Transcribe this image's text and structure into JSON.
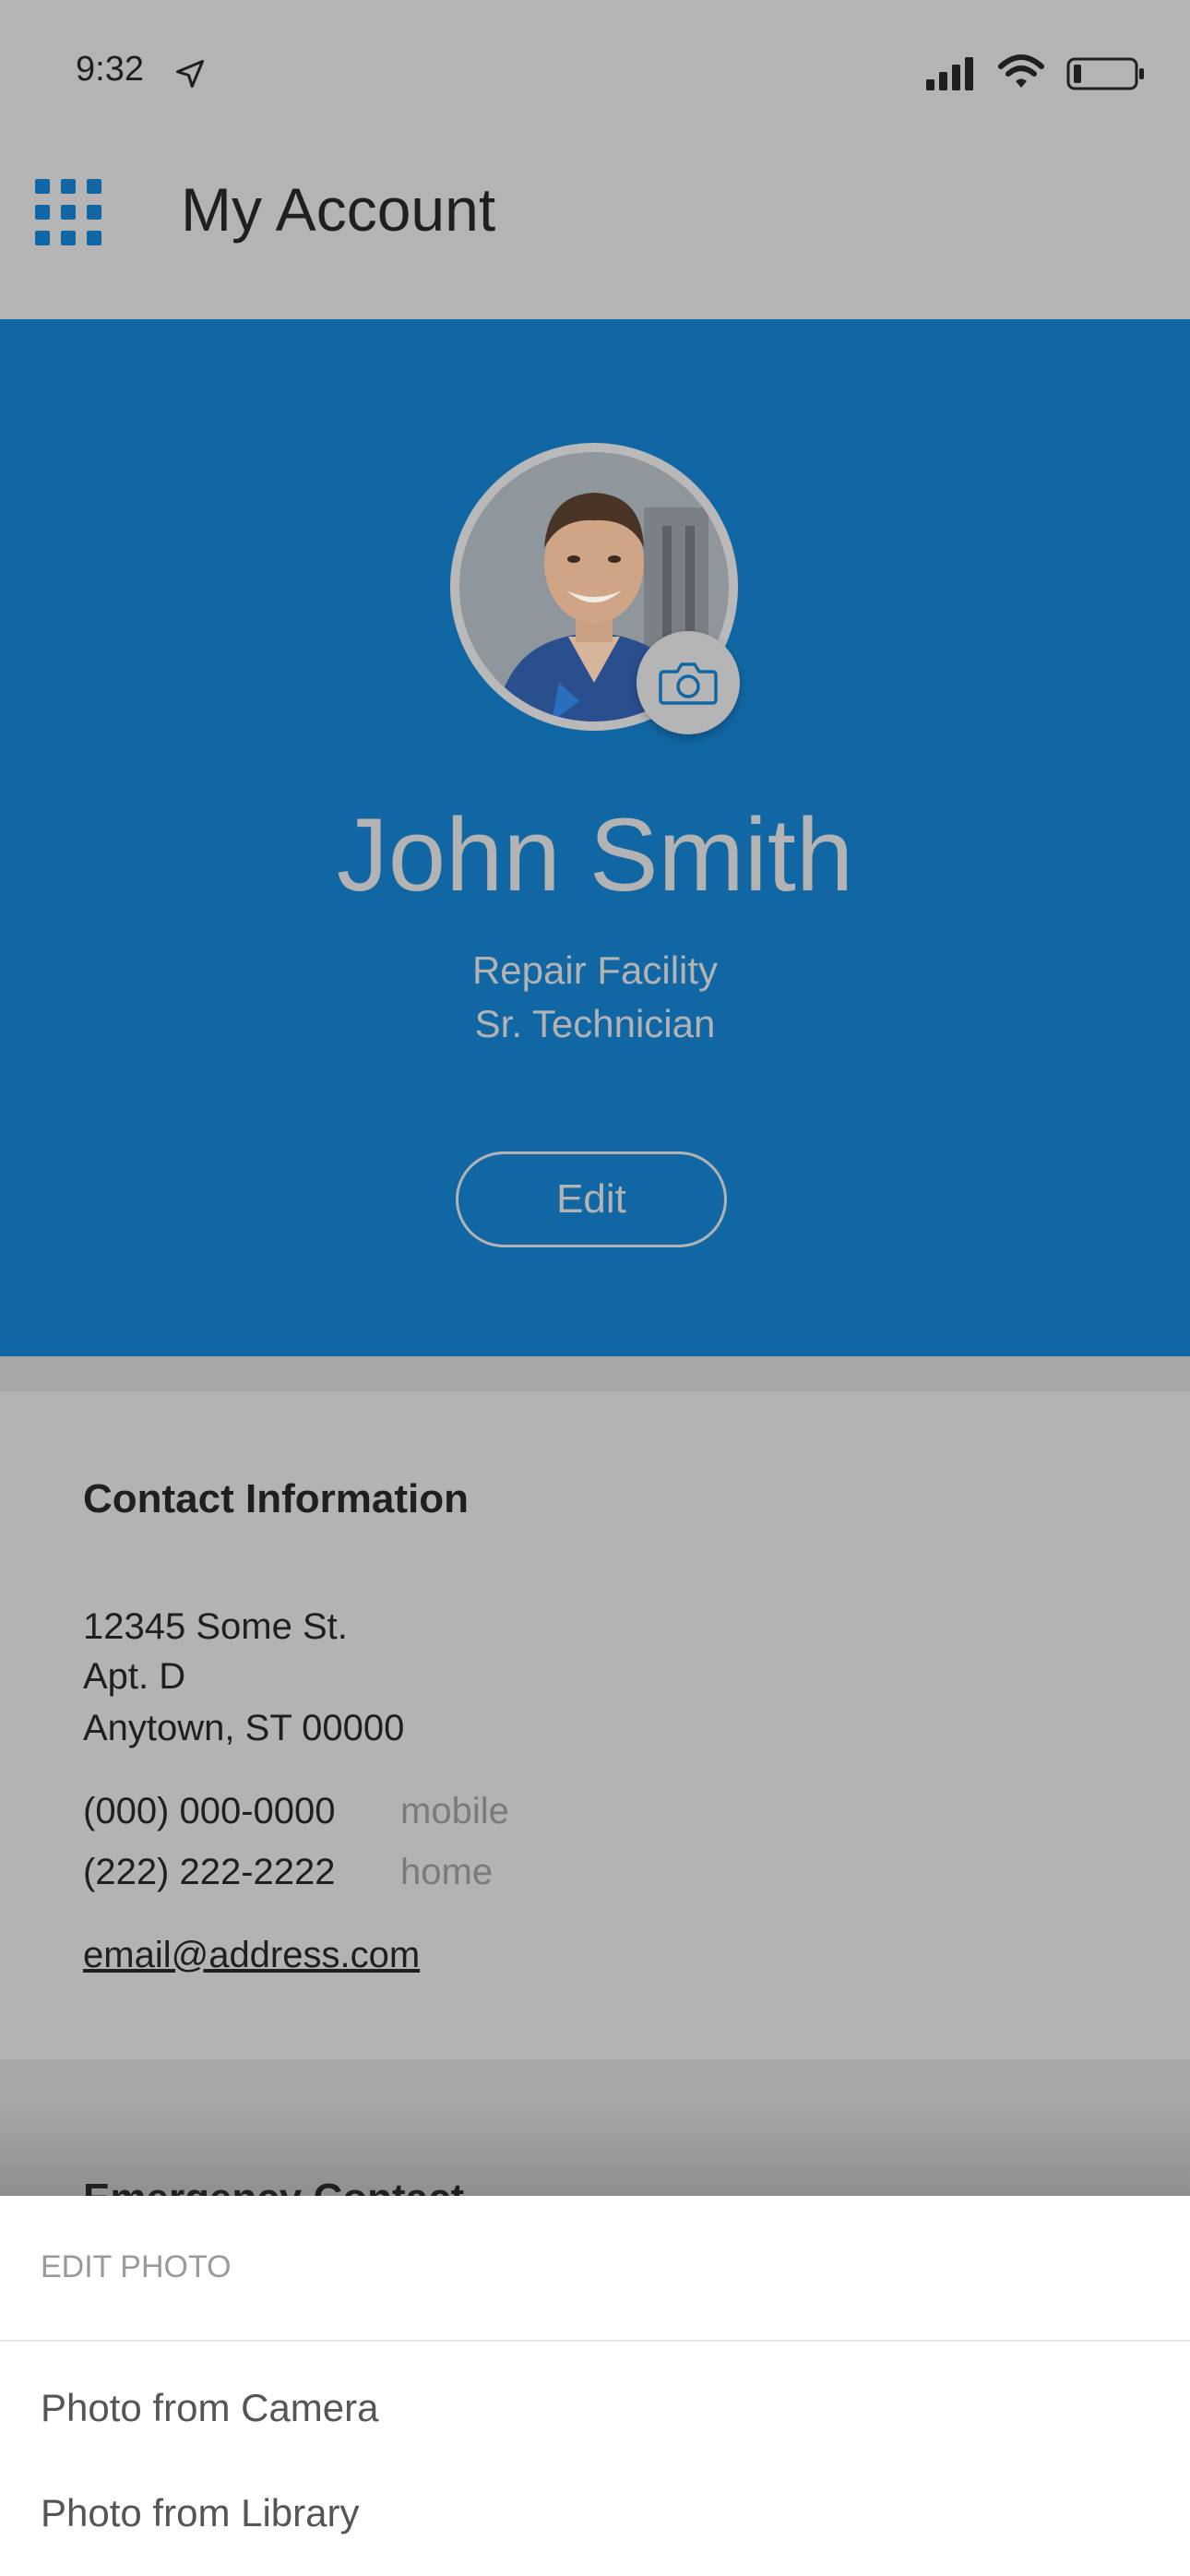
{
  "status": {
    "time": "9:32"
  },
  "header": {
    "title": "My Account"
  },
  "profile": {
    "name": "John Smith",
    "facility": "Repair Facility",
    "role": "Sr. Technician",
    "edit_label": "Edit"
  },
  "contact": {
    "title": "Contact Information",
    "address_line1": "12345 Some St.",
    "address_line2": "Apt. D",
    "address_line3": "Anytown, ST 00000",
    "phones": [
      {
        "number": "(000) 000-0000",
        "label": "mobile"
      },
      {
        "number": "(222) 222-2222",
        "label": "home"
      }
    ],
    "email": "email@address.com"
  },
  "next_section": {
    "title": "Emergency Contact"
  },
  "sheet": {
    "title": "EDIT PHOTO",
    "items": [
      {
        "label": "Photo from Camera"
      },
      {
        "label": "Photo from Library"
      }
    ]
  },
  "colors": {
    "brand_blue": "#1167a3",
    "overlay_gray": "#b3b3b3",
    "sheet_bg": "#ffffff"
  }
}
